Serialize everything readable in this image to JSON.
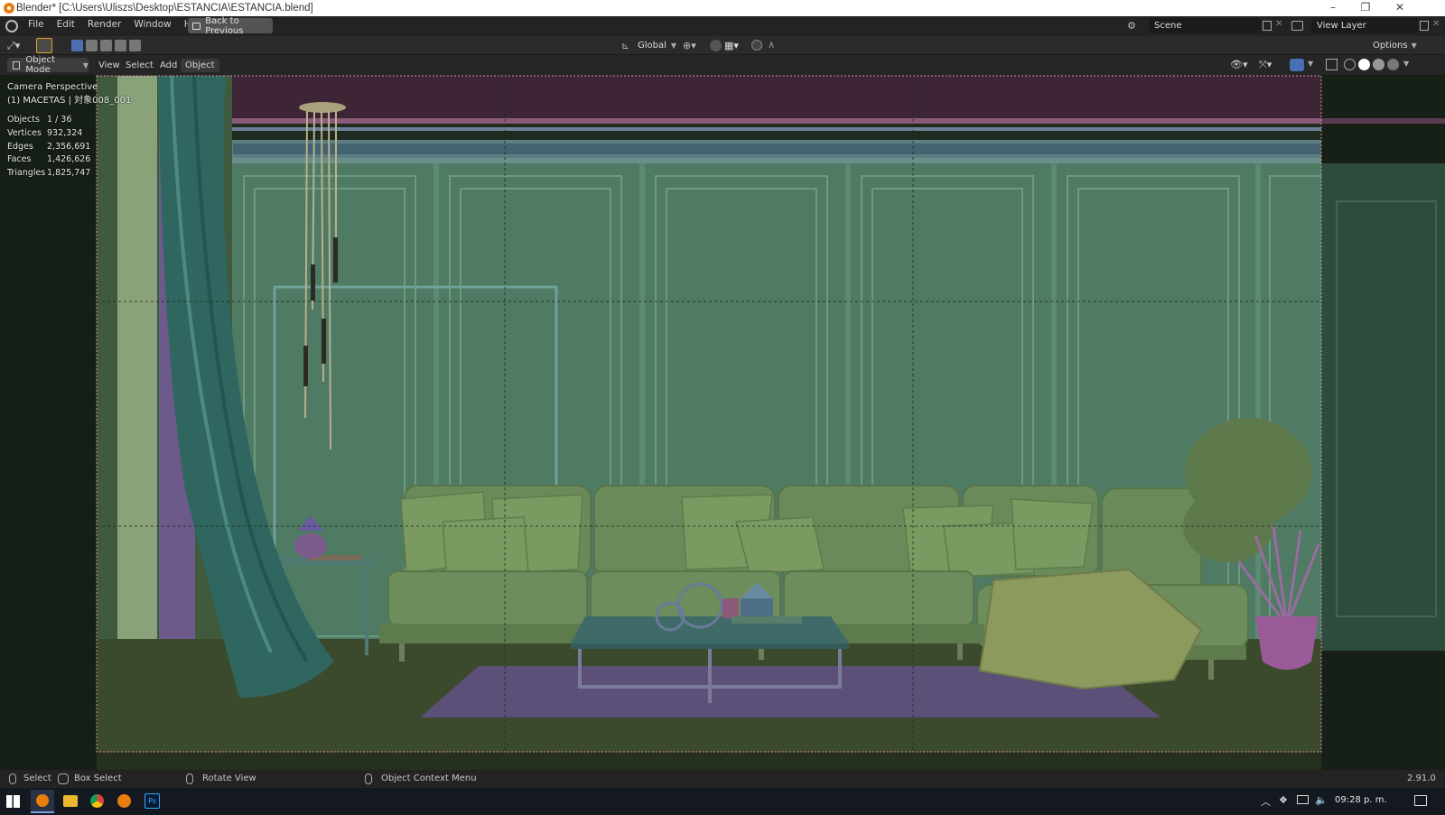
{
  "window": {
    "title": "Blender* [C:\\Users\\Uliszs\\Desktop\\ESTANCIA\\ESTANCIA.blend]",
    "minimize": "–",
    "restore": "❐",
    "close": "✕"
  },
  "menubar": {
    "items": [
      "File",
      "Edit",
      "Render",
      "Window",
      "Help"
    ],
    "back_button": "Back to Previous",
    "scene_label": "Scene",
    "view_layer_label": "View Layer"
  },
  "tool_header": {
    "transform_orientation": "Global",
    "options_label": "Options"
  },
  "viewport_header": {
    "mode": "Object Mode",
    "menus": [
      "View",
      "Select",
      "Add",
      "Object"
    ]
  },
  "overlay": {
    "view_name": "Camera Perspective",
    "active_object": "(1) MACETAS | 対象008_001",
    "stats": [
      {
        "label": "Objects",
        "value": "1 / 36"
      },
      {
        "label": "Vertices",
        "value": "932,324"
      },
      {
        "label": "Edges",
        "value": "2,356,691"
      },
      {
        "label": "Faces",
        "value": "1,426,626"
      },
      {
        "label": "Triangles",
        "value": "1,825,747"
      }
    ]
  },
  "statusbar": {
    "select": "Select",
    "box_select": "Box Select",
    "rotate_view": "Rotate View",
    "context_menu": "Object Context Menu",
    "version": "2.91.0"
  },
  "taskbar": {
    "clock": "09:28 p. m.",
    "ps_label": "Ps"
  },
  "colors": {
    "wall": "#4f7a64",
    "panel_line": "#6d9a80",
    "sofa": "#6b8a5a",
    "floor": "#3b4a2c",
    "rug": "#5c4f78",
    "curtain": "#2f6660",
    "ceiling": "#3a2332"
  }
}
